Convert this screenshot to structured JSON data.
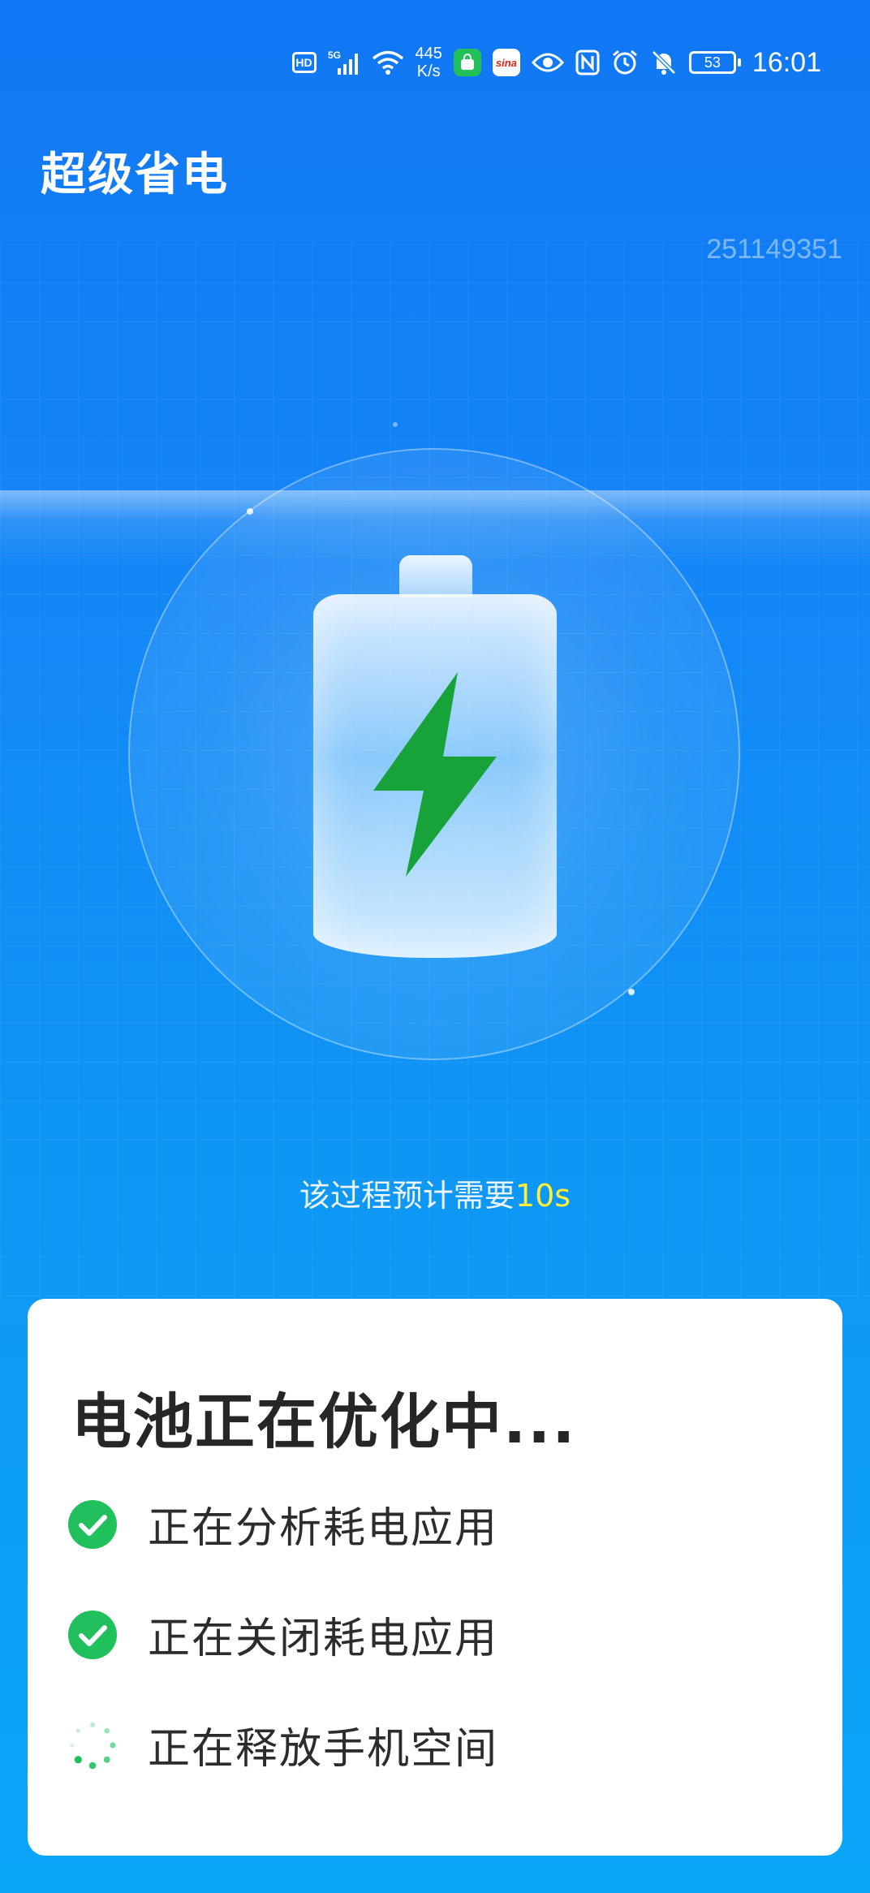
{
  "status_bar": {
    "hd": "HD",
    "network": "5G",
    "speed_value": "445",
    "speed_unit": "K/s",
    "app_badge_1": "",
    "app_badge_2": "sina",
    "battery": "53",
    "time": "16:01"
  },
  "header": {
    "title": "超级省电",
    "device_id": "251149351"
  },
  "estimate": {
    "prefix": "该过程预计需要",
    "time": "10s"
  },
  "card": {
    "title": "电池正在优化中...",
    "tasks": [
      {
        "label": "正在分析耗电应用",
        "status": "done"
      },
      {
        "label": "正在关闭耗电应用",
        "status": "done"
      },
      {
        "label": "正在释放手机空间",
        "status": "loading"
      }
    ]
  },
  "colors": {
    "accent_green": "#20c05c",
    "bolt_green": "#17a33a",
    "highlight_yellow": "#ffee3a"
  }
}
